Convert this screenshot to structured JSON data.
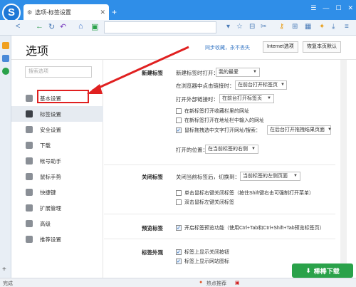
{
  "browser": {
    "tab_title": "选项-标签设置",
    "tab_close": "✕",
    "new_tab": "+",
    "window_controls": [
      "☰",
      "—",
      "☐",
      "✕"
    ],
    "status_left": "完成",
    "status_hot": "热点推荐",
    "status_zoom": "⊕"
  },
  "options": {
    "title": "选项",
    "sync_link": "同步收藏，永不丢失",
    "internet_options": "Internet选项",
    "restore_defaults": "恢复本页默认",
    "search_placeholder": "搜索选项"
  },
  "sidebar": {
    "items": [
      {
        "label": "基本设置",
        "icon": "gear-icon"
      },
      {
        "label": "标签设置",
        "icon": "tab-icon"
      },
      {
        "label": "安全设置",
        "icon": "shield-icon"
      },
      {
        "label": "下载",
        "icon": "download-icon"
      },
      {
        "label": "帐号助手",
        "icon": "key-icon"
      },
      {
        "label": "鼠标手势",
        "icon": "mouse-icon"
      },
      {
        "label": "快捷键",
        "icon": "keyboard-icon"
      },
      {
        "label": "扩展管理",
        "icon": "extension-icon"
      },
      {
        "label": "高级",
        "icon": "more-icon"
      },
      {
        "label": "推荐设置",
        "icon": "recommend-icon"
      }
    ]
  },
  "new_tab_section": {
    "heading": "新建标签",
    "open_new_tab_label": "新建标签时打开：",
    "open_new_tab_value": "我的最爱",
    "middle_click_label": "在浏览器中点击链接时：",
    "middle_click_value": "在前台打开标签页",
    "external_link_label": "打开外部链接时：",
    "external_link_value": "在前台打开标签页",
    "check_fav_bar": "在新标签打开收藏栏里的网址",
    "check_address_bar": "在新标签打开在地址栏中输入的网址",
    "check_drag_label": "鼠标拖拽选中文字打开网址/搜索：",
    "check_drag_value": "在后台打开拖拽结果页面",
    "open_position_label": "打开的位置：",
    "open_position_value": "在当前标签的右侧"
  },
  "close_tab_section": {
    "heading": "关闭标签",
    "after_close_label": "关闭当前标签后，切换到：",
    "after_close_value": "当前标签的左侧页面",
    "check_right_click": "单击鼠标右键关闭标签（按住Shift键右击可强制打开菜单）",
    "check_double_click": "双击鼠标左键关闭标签"
  },
  "preview_section": {
    "heading": "预览标签",
    "check_preview": "开启标签预览功能（使用Ctrl+Tab和Ctrl+Shift+Tab预览标签页）"
  },
  "appearance_section": {
    "heading": "标签外观",
    "check_close_button": "标签上显示关闭按钮",
    "check_site_icon": "标签上显示网站图标"
  },
  "checkbox_states": {
    "fav_bar": false,
    "address_bar": false,
    "drag": true,
    "right_click": false,
    "double_click": false,
    "preview": true,
    "close_button": true,
    "site_icon": true
  },
  "watermark": "棒棒下载",
  "colors": {
    "title_bar": "#2f8ee8",
    "annotation": "#e02020",
    "link": "#3a79c5"
  }
}
